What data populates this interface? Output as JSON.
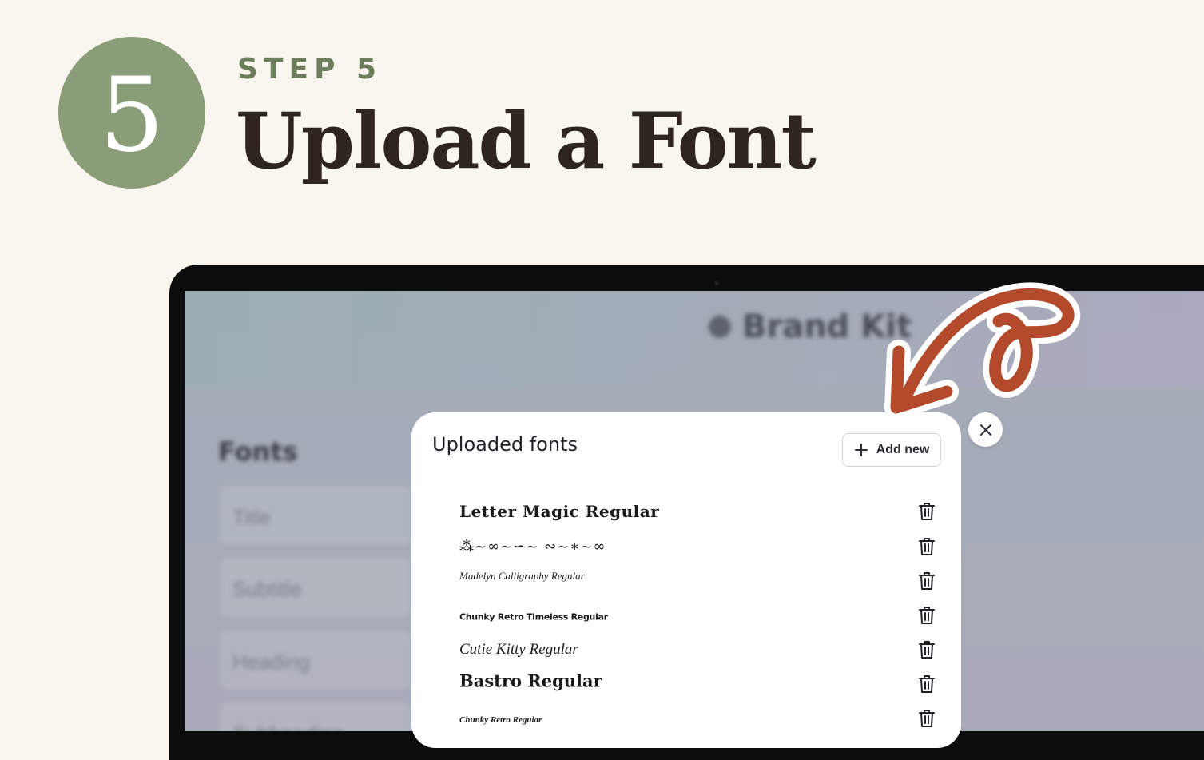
{
  "step": {
    "number": "5",
    "label": "STEP 5",
    "title": "Upload a Font"
  },
  "colors": {
    "background": "#f9f6f0",
    "circle": "#8a9c78",
    "step_label": "#6b7d5b",
    "title": "#2f2520",
    "arrow": "#b24a2b"
  },
  "background_app": {
    "header_title": "Brand Kit",
    "section_heading": "Fonts",
    "fields": [
      "Title",
      "Subtitle",
      "Heading",
      "Subheading"
    ]
  },
  "modal": {
    "title": "Uploaded fonts",
    "add_new_label": "Add new",
    "fonts": [
      {
        "name": "Letter Magic Regular",
        "icon": "trash-icon"
      },
      {
        "name": "⁂~∞~∽~ ∾~∗~∞",
        "icon": "trash-icon"
      },
      {
        "name": "Madelyn Calligraphy Regular",
        "icon": "trash-icon"
      },
      {
        "name": "Chunky Retro Timeless Regular",
        "icon": "trash-icon"
      },
      {
        "name": "Cutie Kitty Regular",
        "icon": "trash-icon"
      },
      {
        "name": "Bastro Regular",
        "icon": "trash-icon"
      },
      {
        "name": "Chunky Retro Regular",
        "icon": "trash-icon"
      }
    ]
  },
  "icons": {
    "add": "plus-icon",
    "close": "close-icon",
    "delete": "trash-icon",
    "pointer": "arrow-icon"
  }
}
